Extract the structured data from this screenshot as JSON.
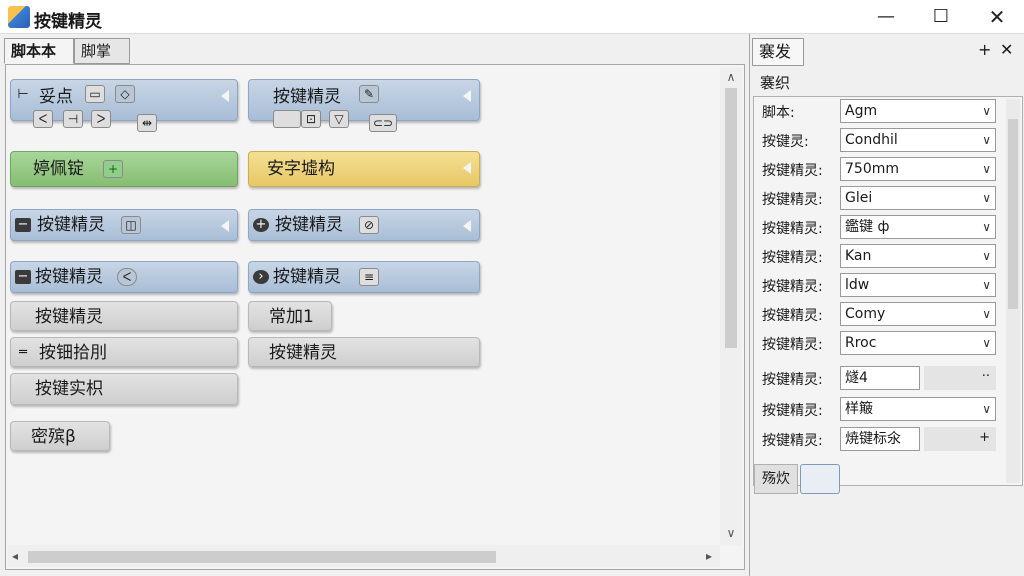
{
  "window": {
    "title": "按键精灵",
    "min_label": "—",
    "max_label": "☐",
    "close_label": "✕"
  },
  "tabs": [
    "脚本本",
    "脚掌"
  ],
  "blocks": [
    {
      "text": "妥点",
      "color": "blue"
    },
    {
      "text": "按键精灵",
      "color": "blue"
    },
    {
      "text": "婷佩锭",
      "color": "green"
    },
    {
      "text": "安字墟构",
      "color": "yellow"
    },
    {
      "text": "按键精灵",
      "color": "blue"
    },
    {
      "text": "按键精灵",
      "color": "blue"
    },
    {
      "text": "按键精灵",
      "color": "blue"
    },
    {
      "text": "按键精灵",
      "color": "blue"
    },
    {
      "text": "按键精灵",
      "color": "gray"
    },
    {
      "text": "常加1",
      "color": "gray"
    },
    {
      "text": "按钿拾刖",
      "color": "gray"
    },
    {
      "text": "按键精灵",
      "color": "gray"
    },
    {
      "text": "按键实枳",
      "color": "gray"
    },
    {
      "text": "密殡β",
      "color": "gray"
    }
  ],
  "panel": {
    "tab": "褰发",
    "section": "褰织",
    "rows": [
      {
        "label": "脚本:",
        "value": "Agm"
      },
      {
        "label": "按键灵:",
        "value": "Condhil"
      },
      {
        "label": "按键精灵:",
        "value": "750mm"
      },
      {
        "label": "按键精灵:",
        "value": "Glei"
      },
      {
        "label": "按键精灵:",
        "value": "鑑键 ф"
      },
      {
        "label": "按键精灵:",
        "value": "Kan"
      },
      {
        "label": "按键精灵:",
        "value": "ldw"
      },
      {
        "label": "按键精灵:",
        "value": "Comy"
      },
      {
        "label": "按键精灵:",
        "value": "Rroc"
      },
      {
        "label": "按键精灵:",
        "value": "燧4"
      },
      {
        "label": "按键精灵:",
        "value": "样簸"
      },
      {
        "label": "按键精灵:",
        "value": "焼键标氽"
      }
    ],
    "bottom_label": "殇炊"
  }
}
